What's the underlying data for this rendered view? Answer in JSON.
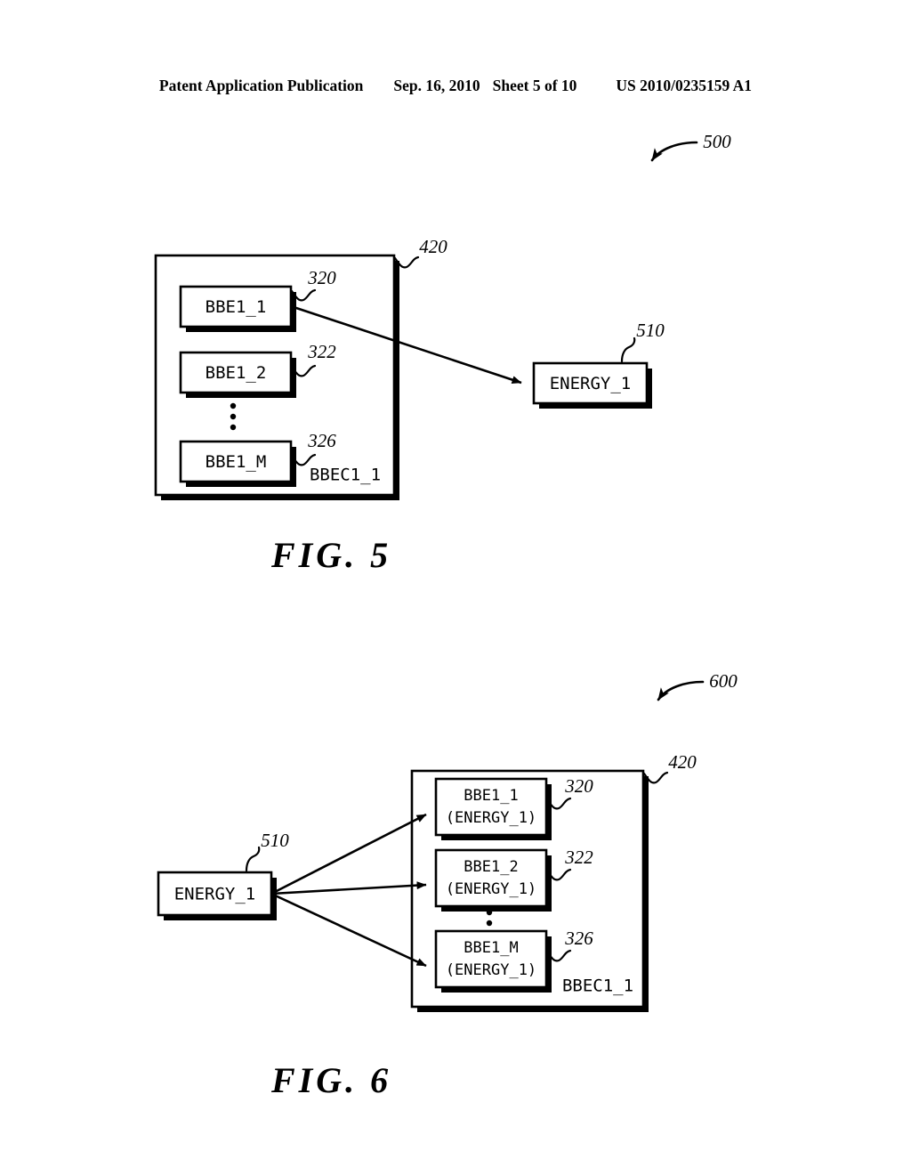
{
  "header": {
    "publication": "Patent Application Publication",
    "date": "Sep. 16, 2010",
    "sheet": "Sheet 5 of 10",
    "patent_number": "US 2010/0235159 A1"
  },
  "figures": [
    {
      "caption": "FIG. 5",
      "callout": "500",
      "container": {
        "ref": "420",
        "label": "BBEC1_1"
      },
      "blocks": [
        {
          "ref": "320",
          "line1": "BBE1_1",
          "line2": ""
        },
        {
          "ref": "322",
          "line1": "BBE1_2",
          "line2": ""
        },
        {
          "ref": "326",
          "line1": "BBE1_M",
          "line2": ""
        }
      ],
      "ellipsis": "⋮",
      "energy": {
        "ref": "510",
        "label": "ENERGY_1"
      },
      "flow": "block-to-energy"
    },
    {
      "caption": "FIG. 6",
      "callout": "600",
      "container": {
        "ref": "420",
        "label": "BBEC1_1"
      },
      "blocks": [
        {
          "ref": "320",
          "line1": "BBE1_1",
          "line2": "(ENERGY_1)"
        },
        {
          "ref": "322",
          "line1": "BBE1_2",
          "line2": "(ENERGY_1)"
        },
        {
          "ref": "326",
          "line1": "BBE1_M",
          "line2": "(ENERGY_1)"
        }
      ],
      "ellipsis": "⋮",
      "energy": {
        "ref": "510",
        "label": "ENERGY_1"
      },
      "flow": "energy-to-blocks"
    }
  ],
  "colors": {
    "ink": "#000000",
    "paper": "#ffffff"
  }
}
